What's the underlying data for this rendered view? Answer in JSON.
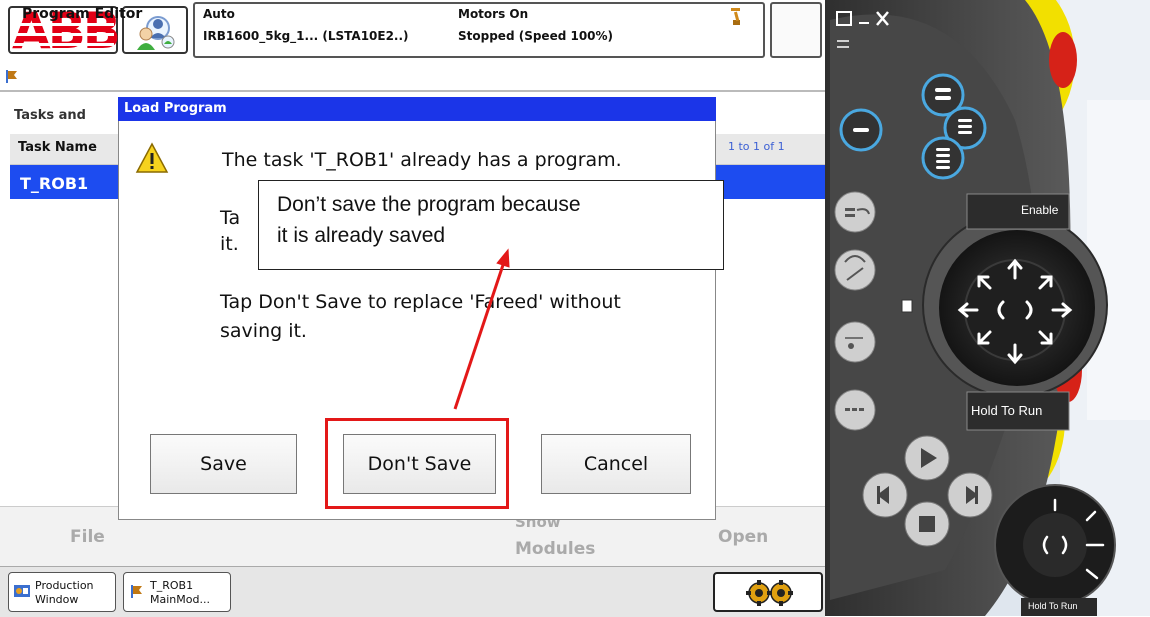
{
  "brand": {
    "logo_text": "ABB"
  },
  "status": {
    "mode": "Auto",
    "robot": "IRB1600_5kg_1... (LSTA10E2..)",
    "motors": "Motors On",
    "state": "Stopped (Speed 100%)"
  },
  "app": {
    "title": "Program Editor"
  },
  "tasks": {
    "label": "Tasks and",
    "column_header": "Task Name",
    "pager": "1 to 1 of 1",
    "rows": [
      "T_ROB1"
    ]
  },
  "dialog": {
    "title": "Load Program",
    "line1": "The task 'T_ROB1' already has a program.",
    "line2a": "Ta",
    "line2b": "it.",
    "line3": "Tap Don't Save to replace 'Fareed' without",
    "line4": "saving it.",
    "buttons": {
      "save": "Save",
      "dont_save": "Don't Save",
      "cancel": "Cancel"
    }
  },
  "callout": {
    "line1": "Don’t save the program because",
    "line2": "it is already saved"
  },
  "commands": {
    "file": "File",
    "show_modules_top": "Show",
    "show_modules": "Modules",
    "open": "Open"
  },
  "taskbar": {
    "production_line1": "Production",
    "production_line2": "Window",
    "task_line1": "T_ROB1",
    "task_line2": "MainMod..."
  },
  "pendant": {
    "enable_label": "Enable",
    "hold_to_run_label": "Hold To Run",
    "hold_to_run_small": "Hold To Run"
  },
  "colors": {
    "brand_red": "#e30016",
    "selection_blue": "#1d4cf0",
    "dialog_title_blue": "#1b35e8",
    "highlight_red": "#e31818",
    "pendant_yellow": "#f2e000",
    "pendant_dark": "#3a3a3a"
  }
}
